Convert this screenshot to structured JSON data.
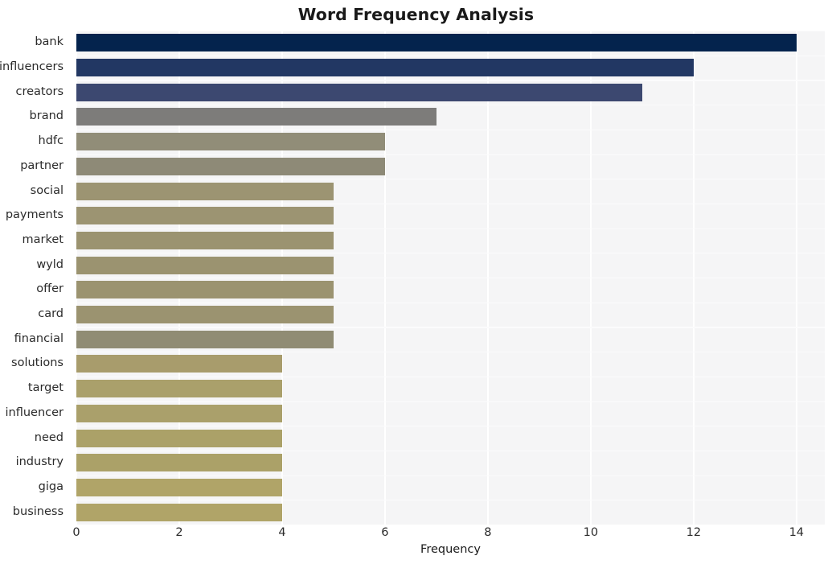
{
  "chart_data": {
    "type": "bar",
    "orientation": "horizontal",
    "title": "Word Frequency Analysis",
    "xlabel": "Frequency",
    "ylabel": "",
    "categories": [
      "bank",
      "influencers",
      "creators",
      "brand",
      "hdfc",
      "partner",
      "social",
      "payments",
      "market",
      "wyld",
      "offer",
      "card",
      "financial",
      "solutions",
      "target",
      "influencer",
      "need",
      "industry",
      "giga",
      "business"
    ],
    "values": [
      14,
      12,
      11,
      7,
      6,
      6,
      5,
      5,
      5,
      5,
      5,
      5,
      5,
      4,
      4,
      4,
      4,
      4,
      4,
      4
    ],
    "bar_colors": [
      "#04234d",
      "#223763",
      "#3c4870",
      "#7d7c7a",
      "#918d78",
      "#8e8a77",
      "#9c9472",
      "#9c9472",
      "#9b9370",
      "#9b9370",
      "#9b9370",
      "#9b9370",
      "#908c74",
      "#a89c6c",
      "#aaa06b",
      "#aaa06b",
      "#aba168",
      "#aba168",
      "#b0a468",
      "#b0a468"
    ],
    "xlim": [
      0,
      14.55
    ],
    "xticks": [
      0,
      2,
      4,
      6,
      8,
      10,
      12,
      14
    ],
    "xtick_labels": [
      "0",
      "2",
      "4",
      "6",
      "8",
      "10",
      "12",
      "14"
    ],
    "grid": "vertical",
    "legend": null,
    "plot_background": "#f5f5f6",
    "figure_background": "#ffffff",
    "gridline_color": "#ffffff"
  }
}
